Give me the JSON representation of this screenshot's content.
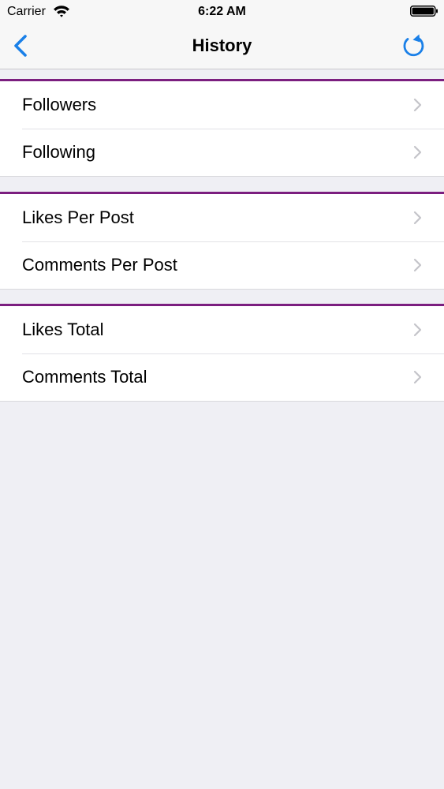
{
  "status_bar": {
    "carrier": "Carrier",
    "time": "6:22 AM",
    "icons": [
      "wifi-icon",
      "battery-icon"
    ]
  },
  "nav": {
    "title": "History",
    "back_icon": "chevron-left-icon",
    "refresh_icon": "refresh-icon",
    "tint_color": "#1a80e8"
  },
  "sections": [
    {
      "items": [
        {
          "label": "Followers"
        },
        {
          "label": "Following"
        }
      ]
    },
    {
      "items": [
        {
          "label": "Likes Per Post"
        },
        {
          "label": "Comments Per Post"
        }
      ]
    },
    {
      "items": [
        {
          "label": "Likes Total"
        },
        {
          "label": "Comments Total"
        }
      ]
    }
  ],
  "colors": {
    "section_accent": "#7b1e7f",
    "background": "#efeff4",
    "chevron": "#c4c4c9"
  }
}
